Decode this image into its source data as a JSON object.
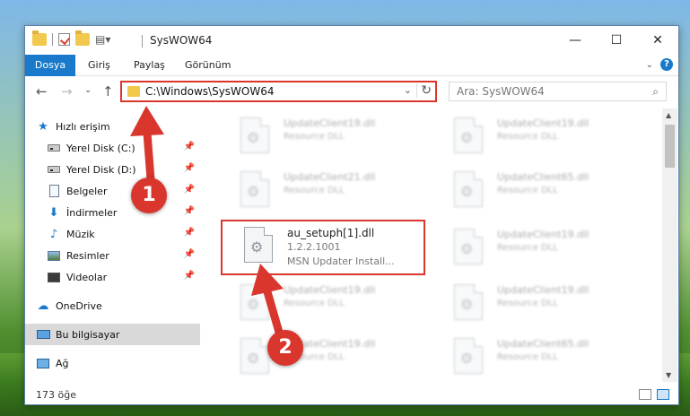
{
  "window": {
    "title": "SysWOW64",
    "minimize_label": "—",
    "maximize_label": "☐",
    "close_label": "✕"
  },
  "ribbon": {
    "tabs": [
      {
        "label": "Dosya"
      },
      {
        "label": "Giriş"
      },
      {
        "label": "Paylaş"
      },
      {
        "label": "Görünüm"
      }
    ],
    "expand_label": "⌄",
    "help_label": "?"
  },
  "navigation": {
    "back_label": "←",
    "forward_label": "→",
    "recent_label": "⌄",
    "up_label": "↑",
    "address": "C:\\Windows\\SysWOW64",
    "search_placeholder": "Ara: SysWOW64"
  },
  "sidebar": {
    "items": [
      {
        "label": "Hızlı erişim",
        "icon": "star-icon"
      },
      {
        "label": "Yerel Disk (C:)",
        "icon": "drive-icon"
      },
      {
        "label": "Yerel Disk (D:)",
        "icon": "drive-icon"
      },
      {
        "label": "Belgeler",
        "icon": "document-icon"
      },
      {
        "label": "İndirmeler",
        "icon": "download-icon"
      },
      {
        "label": "Müzik",
        "icon": "music-icon"
      },
      {
        "label": "Resimler",
        "icon": "pictures-icon"
      },
      {
        "label": "Videolar",
        "icon": "videos-icon"
      },
      {
        "label": "OneDrive",
        "icon": "cloud-icon"
      },
      {
        "label": "Bu bilgisayar",
        "icon": "computer-icon"
      },
      {
        "label": "Ağ",
        "icon": "network-icon"
      }
    ]
  },
  "files": {
    "left_column": [
      {
        "name": "UpdateClient19.dll",
        "type": "Resource DLL"
      },
      {
        "name": "UpdateClient21.dll",
        "type": "Resource DLL"
      },
      {
        "name": "UpdateClient19.dll",
        "type": "Resource DLL"
      },
      {
        "name": "UpdateClient19.dll",
        "type": "Resource DLL"
      }
    ],
    "right_column": [
      {
        "name": "UpdateClient19.dll",
        "type": "Resource DLL"
      },
      {
        "name": "UpdateClient65.dll",
        "type": "Resource DLL"
      },
      {
        "name": "UpdateClient19.dll",
        "type": "Resource DLL"
      },
      {
        "name": "UpdateClient19.dll",
        "type": "Resource DLL"
      },
      {
        "name": "UpdateClient65.dll",
        "type": "Resource DLL"
      }
    ],
    "highlighted": {
      "name": "au_setuph[1].dll",
      "version": "1.2.2.1001",
      "description": "MSN Updater Install..."
    }
  },
  "status": {
    "item_count": "173 öğe"
  },
  "annotations": {
    "step1": "1",
    "step2": "2",
    "color": "#d9362d"
  }
}
